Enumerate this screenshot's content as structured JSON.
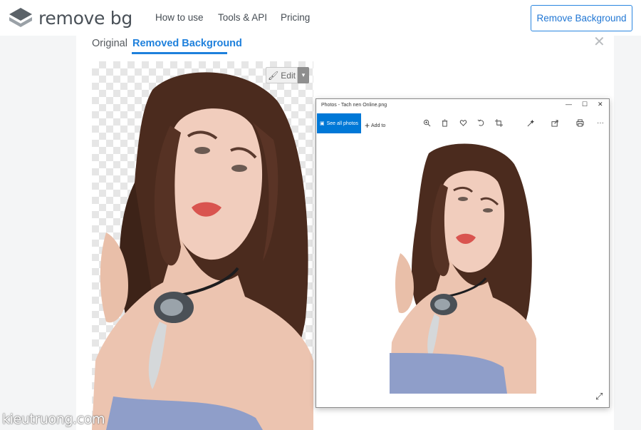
{
  "header": {
    "logo_text": "remove bg",
    "nav": {
      "how_to_use": "How to use",
      "tools_api": "Tools & API",
      "pricing": "Pricing"
    },
    "cta_label": "Remove Background"
  },
  "tabs": {
    "original": "Original",
    "removed": "Removed Background",
    "active": "Removed Background"
  },
  "close_glyph": "✕",
  "editor": {
    "edit_label": "Edit",
    "edit_caret": "▾"
  },
  "photos_window": {
    "title": "Photos - Tach nen Online.png",
    "controls": {
      "minimize": "—",
      "maximize": "☐",
      "close": "✕"
    },
    "toolbar": {
      "see_all": "See all photos",
      "add_to": "Add to",
      "icons": [
        "zoom-in-icon",
        "delete-icon",
        "favorite-icon",
        "rotate-icon",
        "crop-icon",
        "edit-create-icon",
        "share-icon",
        "print-icon",
        "more-icon"
      ]
    },
    "more_glyph": "···",
    "resize_glyph": "⤢"
  },
  "watermark": "kieutruong.com",
  "colors": {
    "accent": "#1e80dc",
    "photos_blue": "#0078d7",
    "logo_gray": "#4a5158"
  }
}
